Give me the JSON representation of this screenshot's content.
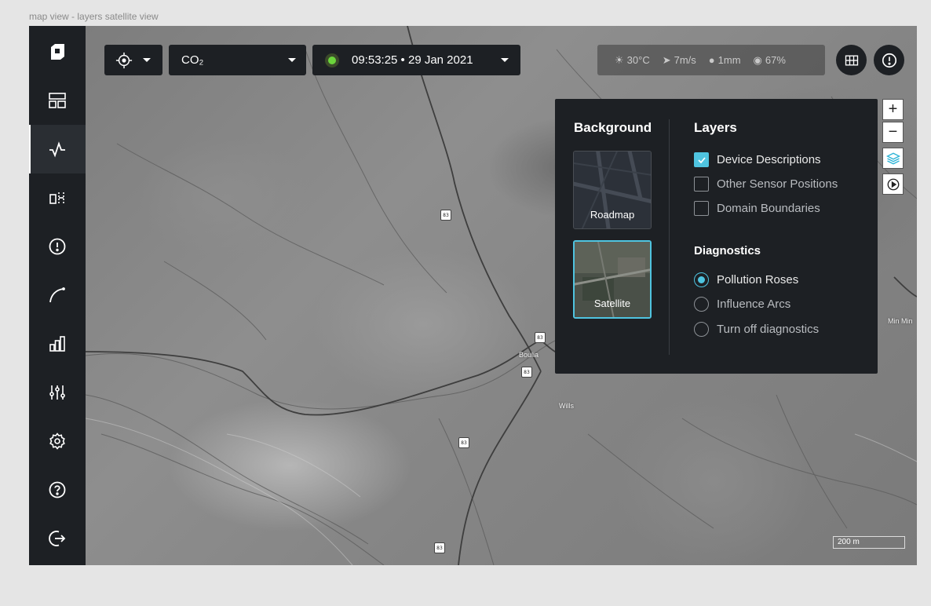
{
  "frame_label": "map view - layers satellite view",
  "toolbar": {
    "gas_label": "CO₂",
    "time_label": "09:53:25 • 29 Jan 2021"
  },
  "weather": {
    "temperature": "30°C",
    "wind": "7m/s",
    "rain": "1mm",
    "humidity": "67%"
  },
  "zoom": {
    "in_label": "+",
    "out_label": "−"
  },
  "panel": {
    "background_title": "Background",
    "backgrounds": [
      {
        "label": "Roadmap",
        "selected": false
      },
      {
        "label": "Satellite",
        "selected": true
      }
    ],
    "layers_title": "Layers",
    "layers": [
      {
        "label": "Device Descriptions",
        "checked": true
      },
      {
        "label": "Other Sensor Positions",
        "checked": false
      },
      {
        "label": "Domain Boundaries",
        "checked": false
      }
    ],
    "diagnostics_title": "Diagnostics",
    "diagnostics": [
      {
        "label": "Pollution Roses",
        "selected": true
      },
      {
        "label": "Influence Arcs",
        "selected": false
      },
      {
        "label": "Turn off diagnostics",
        "selected": false
      }
    ]
  },
  "map_labels": {
    "road_number": "83",
    "town_boulia": "Boulia",
    "town_wills": "Wills",
    "edge_label": "Min Min"
  },
  "scale_label": "200 m",
  "colors": {
    "accent": "#4fc4e0",
    "sidebar": "#1d2024",
    "live": "#6bd43c"
  },
  "icons": [
    "logo-icon",
    "dashboard-icon",
    "pulse-icon",
    "devices-icon",
    "alert-icon",
    "route-icon",
    "bar-chart-icon",
    "sliders-icon",
    "gear-icon",
    "help-icon",
    "logout-icon",
    "crosshair-icon",
    "grid-icon",
    "alert-circle-icon",
    "layers-icon",
    "play-icon"
  ]
}
